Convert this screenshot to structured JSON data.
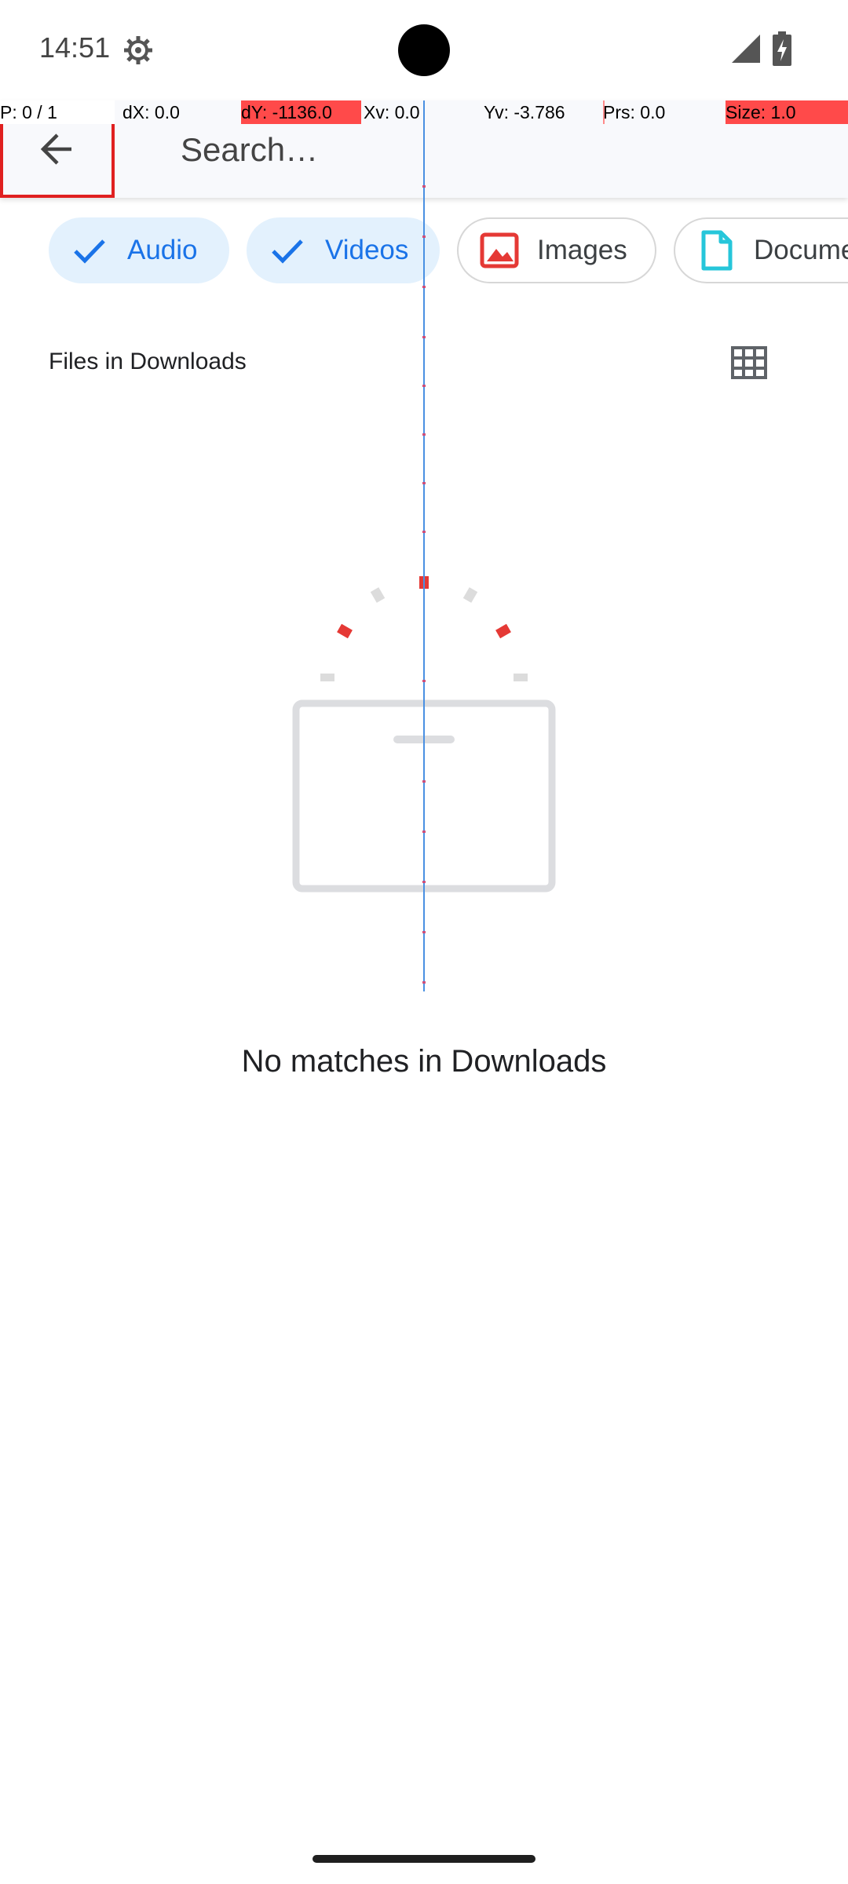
{
  "status_bar": {
    "time": "14:51",
    "icons": [
      "settings-gear-icon",
      "cellular-signal-icon",
      "battery-charging-icon"
    ]
  },
  "pointer_overlay": {
    "pointer": "P: 0 / 1",
    "dx": "dX: 0.0",
    "dy": "dY: -1136.0",
    "xv": "Xv: 0.0",
    "yv": "Yv: -3.786",
    "prs": "Prs: 0.0",
    "size": "Size: 1.0"
  },
  "toolbar": {
    "back_icon": "arrow-back-icon",
    "search_placeholder": "Search…"
  },
  "filters": [
    {
      "label": "Audio",
      "selected": true,
      "icon": "checkmark-icon"
    },
    {
      "label": "Videos",
      "selected": true,
      "icon": "checkmark-icon"
    },
    {
      "label": "Images",
      "selected": false,
      "icon": "image-icon"
    },
    {
      "label": "Documents",
      "selected": false,
      "icon": "document-icon"
    }
  ],
  "section": {
    "title": "Files in Downloads",
    "view_toggle_icon": "grid-view-icon"
  },
  "empty_state": {
    "message": "No matches in Downloads"
  },
  "colors": {
    "accent": "#1a73e8",
    "chip_selected_bg": "#e3f1fd",
    "highlight_red": "#ff4a4a",
    "toolbar_bg": "#f8f9fc"
  }
}
